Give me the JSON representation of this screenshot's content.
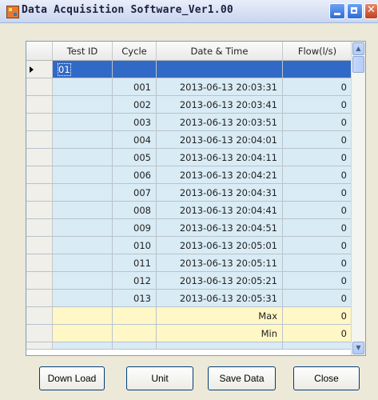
{
  "window": {
    "title": "Data Acquisition Software_Ver1.00"
  },
  "grid": {
    "columns": [
      "Test ID",
      "Cycle",
      "Date & Time",
      "Flow(l/s)"
    ],
    "selected_row": {
      "test_id": "01"
    },
    "rows": [
      {
        "cycle": "001",
        "datetime": "2013-06-13 20:03:31",
        "flow": "0"
      },
      {
        "cycle": "002",
        "datetime": "2013-06-13 20:03:41",
        "flow": "0"
      },
      {
        "cycle": "003",
        "datetime": "2013-06-13 20:03:51",
        "flow": "0"
      },
      {
        "cycle": "004",
        "datetime": "2013-06-13 20:04:01",
        "flow": "0"
      },
      {
        "cycle": "005",
        "datetime": "2013-06-13 20:04:11",
        "flow": "0"
      },
      {
        "cycle": "006",
        "datetime": "2013-06-13 20:04:21",
        "flow": "0"
      },
      {
        "cycle": "007",
        "datetime": "2013-06-13 20:04:31",
        "flow": "0"
      },
      {
        "cycle": "008",
        "datetime": "2013-06-13 20:04:41",
        "flow": "0"
      },
      {
        "cycle": "009",
        "datetime": "2013-06-13 20:04:51",
        "flow": "0"
      },
      {
        "cycle": "010",
        "datetime": "2013-06-13 20:05:01",
        "flow": "0"
      },
      {
        "cycle": "011",
        "datetime": "2013-06-13 20:05:11",
        "flow": "0"
      },
      {
        "cycle": "012",
        "datetime": "2013-06-13 20:05:21",
        "flow": "0"
      },
      {
        "cycle": "013",
        "datetime": "2013-06-13 20:05:31",
        "flow": "0"
      }
    ],
    "summary": [
      {
        "label": "Max",
        "flow": "0"
      },
      {
        "label": "Min",
        "flow": "0"
      }
    ]
  },
  "buttons": {
    "download": "Down Load",
    "unit": "Unit",
    "save": "Save Data",
    "close": "Close"
  },
  "colors": {
    "selected_row": "#3169c6",
    "data_row": "#d9ebf5",
    "summary_row": "#fff7c6"
  }
}
